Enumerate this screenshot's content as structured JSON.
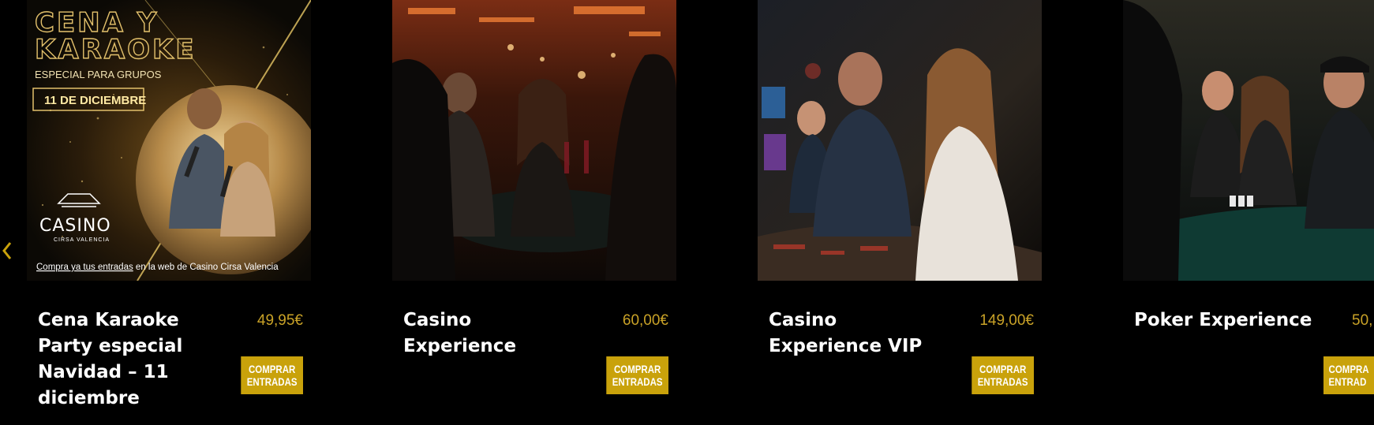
{
  "carousel": {
    "prev_icon": "chevron-left-icon",
    "accent_color": "#c9a20b",
    "cards": [
      {
        "title": "Cena Karaoke Party especial Navidad – 11 diciembre",
        "price": "49,95€",
        "button_line1": "COMPRAR",
        "button_line2": "ENTRADAS",
        "poster": {
          "headline_1": "CENA Y",
          "headline_2": "KARAOKE",
          "subtitle": "ESPECIAL PARA GRUPOS",
          "date": "11 DE DICIEMBRE",
          "logo_text": "CASINO",
          "logo_subtext": "CIRSA VALENCIA",
          "footer_link": "Compra ya tus entradas",
          "footer_rest": " en la web de  Casino Cirsa Valencia"
        }
      },
      {
        "title": "Casino Experience",
        "price": "60,00€",
        "button_line1": "COMPRAR",
        "button_line2": "ENTRADAS"
      },
      {
        "title": "Casino Experience VIP",
        "price": "149,00€",
        "button_line1": "COMPRAR",
        "button_line2": "ENTRADAS"
      },
      {
        "title": "Poker Experience",
        "price": "50,",
        "button_line1": "COMPRA",
        "button_line2": "ENTRAD"
      }
    ]
  }
}
